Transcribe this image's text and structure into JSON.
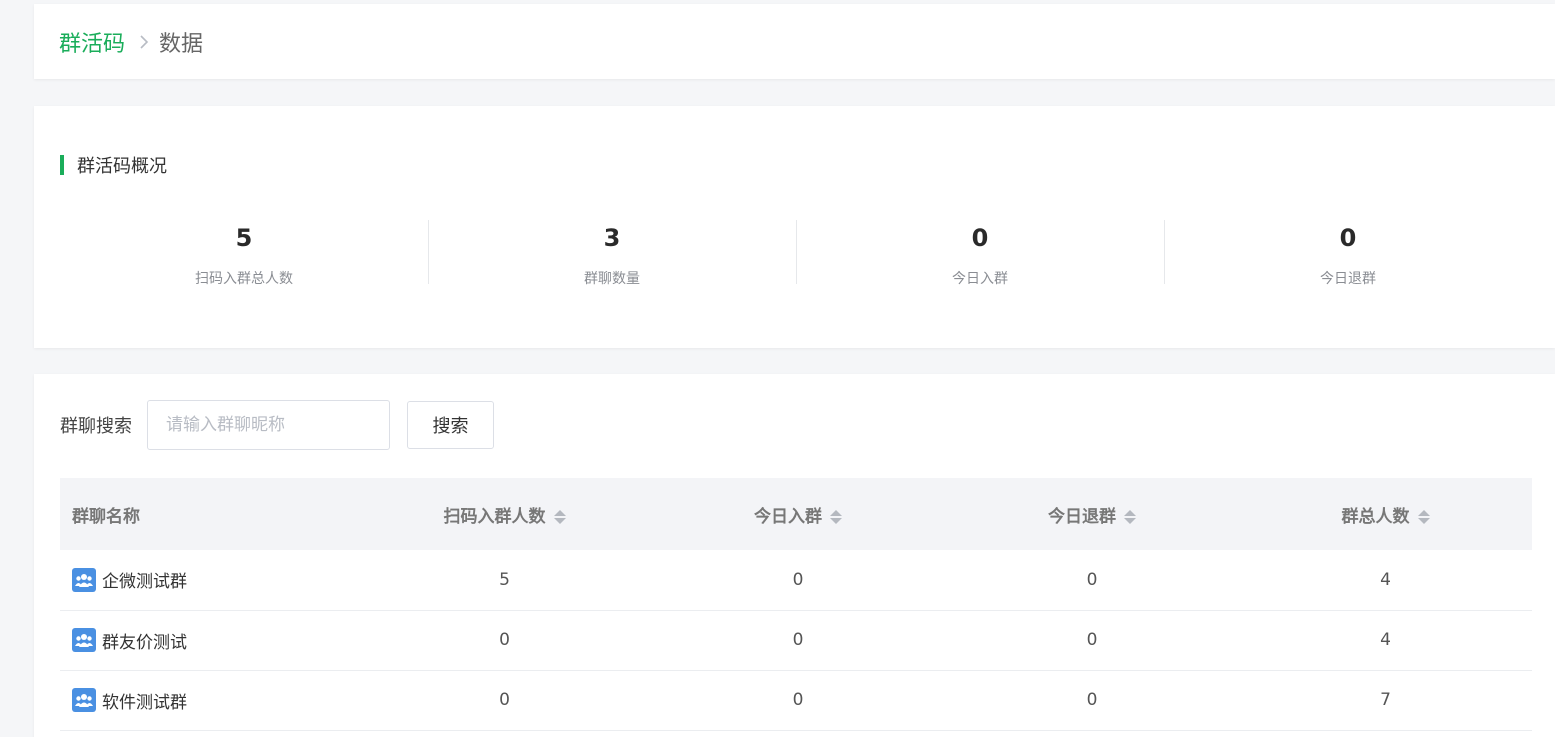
{
  "breadcrumb": {
    "parent": "群活码",
    "current": "数据"
  },
  "overview": {
    "title": "群活码概况",
    "stats": [
      {
        "value": "5",
        "label": "扫码入群总人数"
      },
      {
        "value": "3",
        "label": "群聊数量"
      },
      {
        "value": "0",
        "label": "今日入群"
      },
      {
        "value": "0",
        "label": "今日退群"
      }
    ]
  },
  "search": {
    "label": "群聊搜索",
    "placeholder": "请输入群聊昵称",
    "button": "搜索"
  },
  "table": {
    "columns": [
      "群聊名称",
      "扫码入群人数",
      "今日入群",
      "今日退群",
      "群总人数"
    ],
    "rows": [
      {
        "name": "企微测试群",
        "scan_join": "5",
        "today_join": "0",
        "today_leave": "0",
        "total": "4"
      },
      {
        "name": "群友价测试",
        "scan_join": "0",
        "today_join": "0",
        "today_leave": "0",
        "total": "4"
      },
      {
        "name": "软件测试群",
        "scan_join": "0",
        "today_join": "0",
        "today_leave": "0",
        "total": "7"
      }
    ]
  },
  "colors": {
    "accent": "#1aad5a",
    "group_icon": "#4a90e2"
  }
}
